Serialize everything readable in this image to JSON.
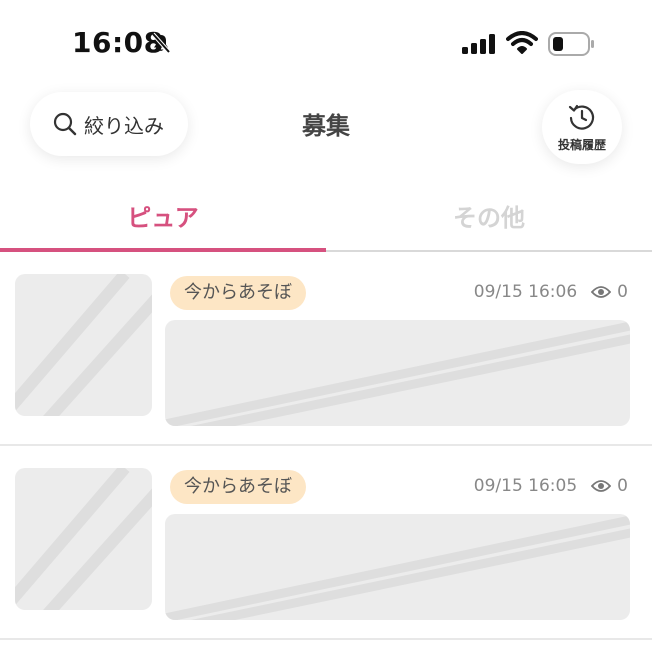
{
  "status_bar": {
    "time": "16:08",
    "icons": [
      "bell-slash-icon",
      "signal-icon",
      "wifi-icon",
      "battery-icon"
    ]
  },
  "header": {
    "filter_label": "絞り込み",
    "title": "募集",
    "history_label": "投稿履歴"
  },
  "tabs": [
    {
      "label": "ピュア",
      "active": true
    },
    {
      "label": "その他",
      "active": false
    }
  ],
  "posts": [
    {
      "tag": "今からあそぼ",
      "timestamp": "09/15 16:06",
      "views": "0"
    },
    {
      "tag": "今からあそぼ",
      "timestamp": "09/15 16:05",
      "views": "0"
    }
  ],
  "colors": {
    "accent": "#d6517f",
    "tag_bg": "#fde6c5",
    "placeholder": "#ececec",
    "inactive_tab": "#d4d4d4"
  }
}
